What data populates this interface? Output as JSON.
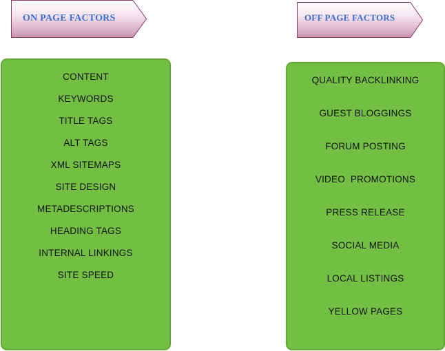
{
  "on_page": {
    "title": "ON PAGE FACTORS",
    "items": [
      "CONTENT",
      "KEYWORDS",
      "TITLE TAGS",
      "ALT TAGS",
      "XML SITEMAPS",
      "SITE DESIGN",
      "METADESCRIPTIONS",
      "HEADING TAGS",
      "INTERNAL LINKINGS",
      "SITE SPEED"
    ]
  },
  "off_page": {
    "title": "OFF PAGE FACTORS",
    "items": [
      "QUALITY BACKLINKING",
      "GUEST BLOGGINGS",
      "FORUM POSTING",
      "VIDEO  PROMOTIONS",
      "PRESS RELEASE",
      "SOCIAL MEDIA",
      "LOCAL LISTINGS",
      "YELLOW PAGES"
    ]
  },
  "colors": {
    "box_fill": "#72bf44",
    "box_border": "#5ea832",
    "tag_text": "#3b6fd1",
    "tag_border": "#8a3c6c"
  }
}
